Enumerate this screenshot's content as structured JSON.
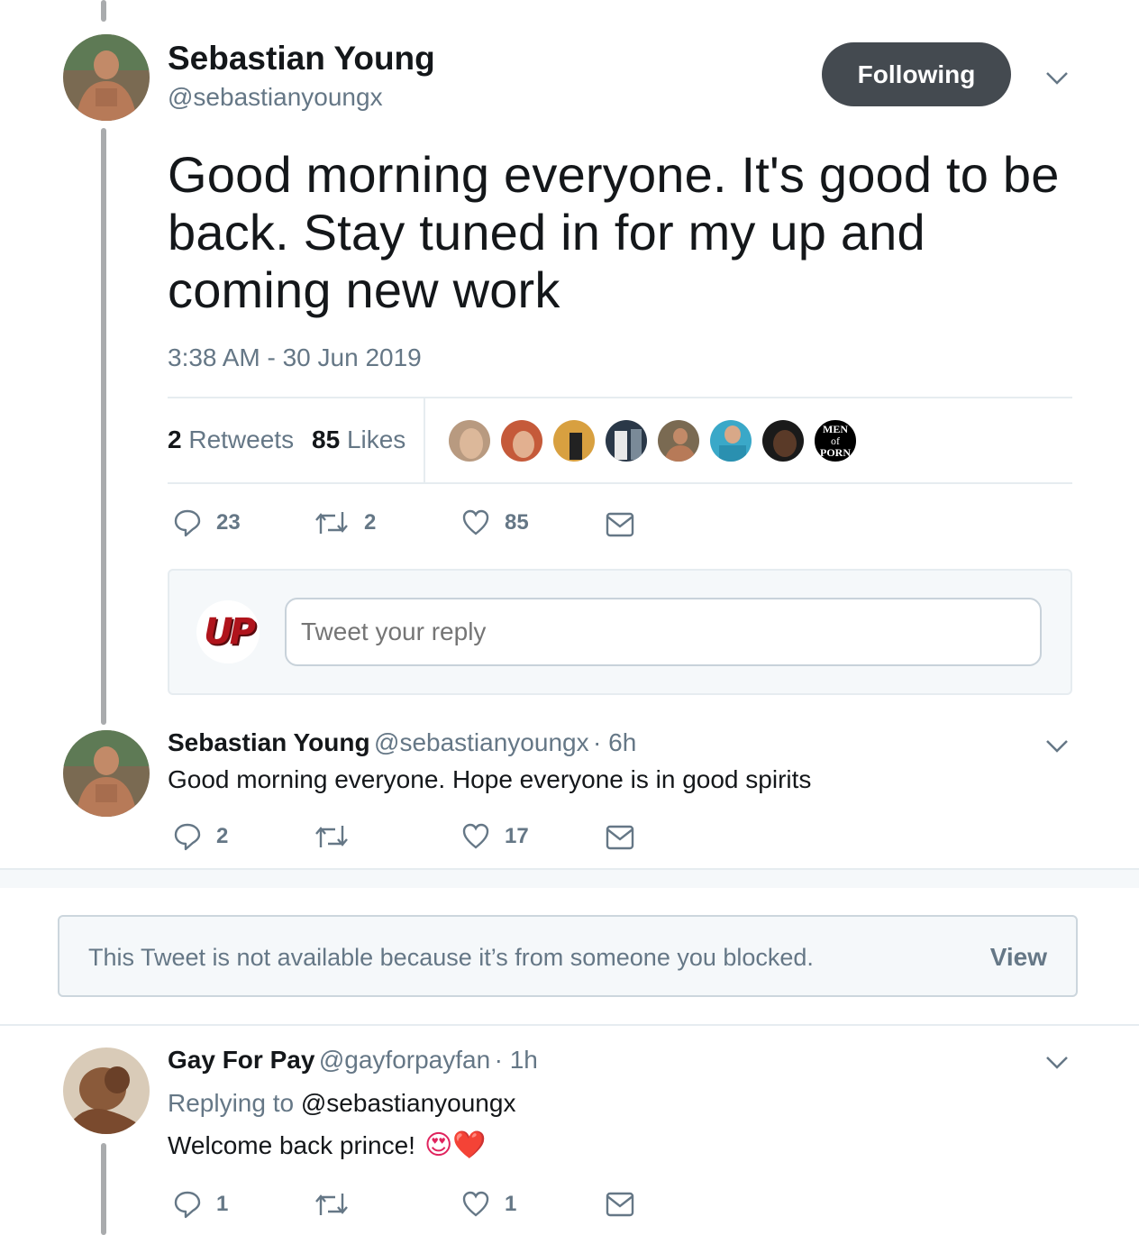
{
  "main_tweet": {
    "author_name": "Sebastian Young",
    "author_handle": "@sebastianyoungx",
    "follow_label": "Following",
    "text_line1": "Good morning everyone. It's good to be",
    "text_line2": "back. Stay tuned in for my up and",
    "text_line3": "coming new work",
    "timestamp": "3:38 AM - 30 Jun 2019",
    "retweets_count": "2",
    "retweets_label": "Retweets",
    "likes_count": "85",
    "likes_label": "Likes",
    "likers_last_label": [
      "MEN",
      "of",
      "PORN"
    ],
    "actions": {
      "replies": "23",
      "retweets": "2",
      "likes": "85"
    }
  },
  "reply_box": {
    "placeholder": "Tweet your reply",
    "avatar_text": "UP"
  },
  "reply1": {
    "author_name": "Sebastian Young",
    "author_handle": "@sebastianyoungx",
    "time": "· 6h",
    "text": "Good morning everyone. Hope everyone is in good spirits",
    "actions": {
      "replies": "2",
      "retweets": "",
      "likes": "17"
    }
  },
  "blocked_notice": {
    "text": "This Tweet is not available because it’s from someone you blocked.",
    "view_label": "View"
  },
  "reply2": {
    "author_name": "Gay For Pay",
    "author_handle": "@gayforpayfan",
    "time": "· 1h",
    "replying_prefix": "Replying to",
    "replying_handle": "@sebastianyoungx",
    "text": "Welcome back prince!",
    "emoji": "😍❤️",
    "actions": {
      "replies": "1",
      "retweets": "",
      "likes": "1"
    }
  },
  "colors": {
    "accent_dark": "#444a50",
    "muted": "#657786",
    "border": "#e6ecf0",
    "thread": "#a9abad",
    "like_red": "#e0245e"
  }
}
